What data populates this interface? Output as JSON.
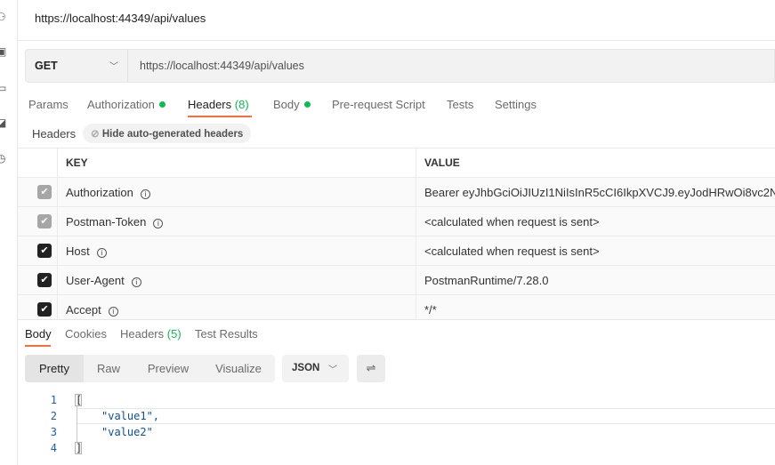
{
  "window": {
    "title": "https://localhost:44349/api/values"
  },
  "sidebar": {
    "icons": [
      "collections-icon",
      "apis-icon",
      "environments-icon",
      "monitors-icon",
      "history-icon"
    ]
  },
  "request": {
    "method": "GET",
    "url": "https://localhost:44349/api/values"
  },
  "tabs": [
    {
      "label": "Params"
    },
    {
      "label": "Authorization",
      "dot": true
    },
    {
      "label": "Headers",
      "count": "(8)",
      "active": true
    },
    {
      "label": "Body",
      "dot": true
    },
    {
      "label": "Pre-request Script"
    },
    {
      "label": "Tests"
    },
    {
      "label": "Settings"
    }
  ],
  "headers_section": {
    "label": "Headers",
    "toggle": "Hide auto-generated headers"
  },
  "table": {
    "columns": [
      "KEY",
      "VALUE"
    ],
    "rows": [
      {
        "key": "Authorization",
        "value": "Bearer eyJhbGciOiJIUzI1NiIsInR5cCI6IkpXVCJ9.eyJodHRwOi8vc2N...",
        "checked": true,
        "disabled": true
      },
      {
        "key": "Postman-Token",
        "value": "<calculated when request is sent>",
        "checked": true,
        "disabled": true
      },
      {
        "key": "Host",
        "value": "<calculated when request is sent>",
        "checked": true,
        "disabled": false
      },
      {
        "key": "User-Agent",
        "value": "PostmanRuntime/7.28.0",
        "checked": true,
        "disabled": false
      },
      {
        "key": "Accept",
        "value": "*/*",
        "checked": true,
        "disabled": false
      }
    ]
  },
  "response": {
    "tabs": [
      {
        "label": "Body",
        "active": true
      },
      {
        "label": "Cookies"
      },
      {
        "label": "Headers",
        "count": "(5)"
      },
      {
        "label": "Test Results"
      }
    ],
    "views": [
      "Pretty",
      "Raw",
      "Preview",
      "Visualize"
    ],
    "active_view": "Pretty",
    "format": "JSON",
    "code": [
      {
        "n": "1",
        "text": "["
      },
      {
        "n": "2",
        "text": "\"value1\","
      },
      {
        "n": "3",
        "text": "\"value2\""
      },
      {
        "n": "4",
        "text": "]"
      }
    ]
  },
  "colors": {
    "accent": "#ff6c37",
    "green": "#0cbb52"
  }
}
